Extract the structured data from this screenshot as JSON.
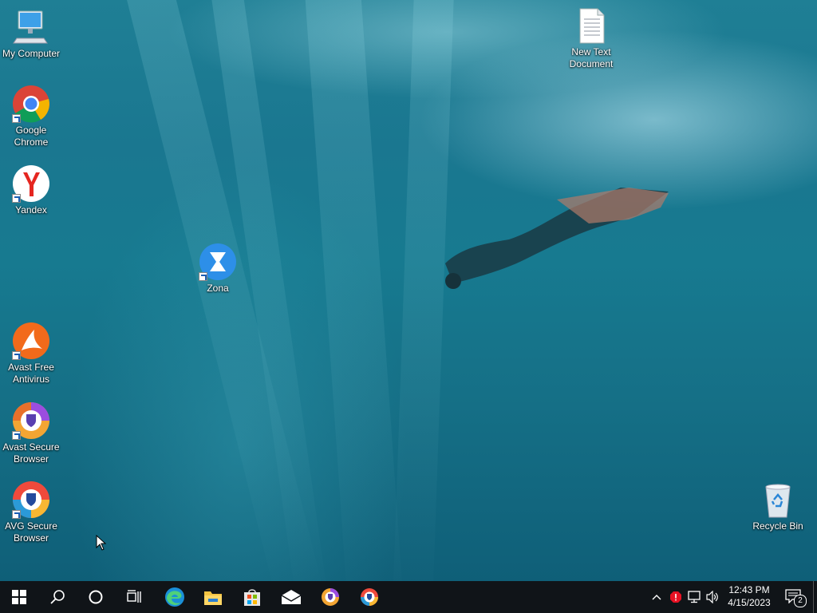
{
  "desktop": {
    "icons": [
      {
        "label": "My Computer",
        "icon": "computer-icon"
      },
      {
        "label": "Google Chrome",
        "icon": "chrome-icon"
      },
      {
        "label": "Yandex",
        "icon": "yandex-icon"
      },
      {
        "label": "Zona",
        "icon": "zona-icon"
      },
      {
        "label": "Avast Free Antivirus",
        "icon": "avast-icon"
      },
      {
        "label": "Avast Secure Browser",
        "icon": "avast-browser-icon"
      },
      {
        "label": "AVG Secure Browser",
        "icon": "avg-browser-icon"
      },
      {
        "label": "New Text Document",
        "icon": "text-document-icon"
      },
      {
        "label": "Recycle Bin",
        "icon": "recycle-bin-icon"
      }
    ]
  },
  "taskbar": {
    "pinned": [
      "start-icon",
      "search-icon",
      "cortana-icon",
      "task-view-icon",
      "edge-icon",
      "file-explorer-icon",
      "store-icon",
      "mail-icon",
      "avast-browser-icon",
      "avg-browser-icon"
    ],
    "tray": {
      "icons": [
        "show-hidden-icons-chevron",
        "security-alert-icon",
        "network-icon",
        "volume-icon"
      ],
      "time": "12:43 PM",
      "date": "4/15/2023",
      "notification_count": "2"
    }
  },
  "colors": {
    "taskbar_bg": "#101418",
    "desktop_water": "#1a7790"
  }
}
